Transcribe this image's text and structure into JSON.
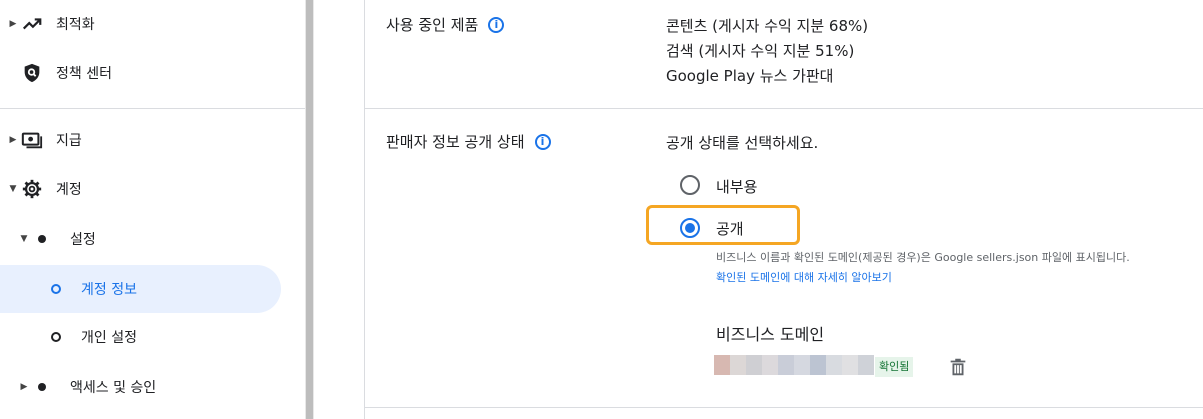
{
  "sidebar": {
    "items": [
      {
        "label": "최적화",
        "icon": "trending-up-icon"
      },
      {
        "label": "정책 센터",
        "icon": "shield-search-icon"
      },
      {
        "label": "지급",
        "icon": "payments-icon"
      },
      {
        "label": "계정",
        "icon": "gear-icon"
      },
      {
        "label": "설정"
      },
      {
        "label": "계정 정보"
      },
      {
        "label": "개인 설정"
      },
      {
        "label": "액세스 및 승인"
      }
    ]
  },
  "products": {
    "label": "사용 중인 제품",
    "values": [
      "콘텐츠 (게시자 수익 지분 68%)",
      "검색 (게시자 수익 지분 51%)",
      "Google Play 뉴스 가판대"
    ]
  },
  "visibility": {
    "label": "판매자 정보 공개 상태",
    "prompt": "공개 상태를 선택하세요.",
    "options": [
      "내부용",
      "공개"
    ],
    "selected": "공개",
    "help_text": "비즈니스 이름과 확인된 도메인(제공된 경우)은 Google sellers.json 파일에 표시됩니다.",
    "help_link": "확인된 도메인에 대해 자세히 알아보기",
    "domain_title": "비즈니스 도메인",
    "verified_badge": "확인됨"
  },
  "colors": {
    "accent": "#1a73e8",
    "highlight": "#f5a623",
    "verified_bg": "#e6f4ea",
    "verified_text": "#137333"
  }
}
